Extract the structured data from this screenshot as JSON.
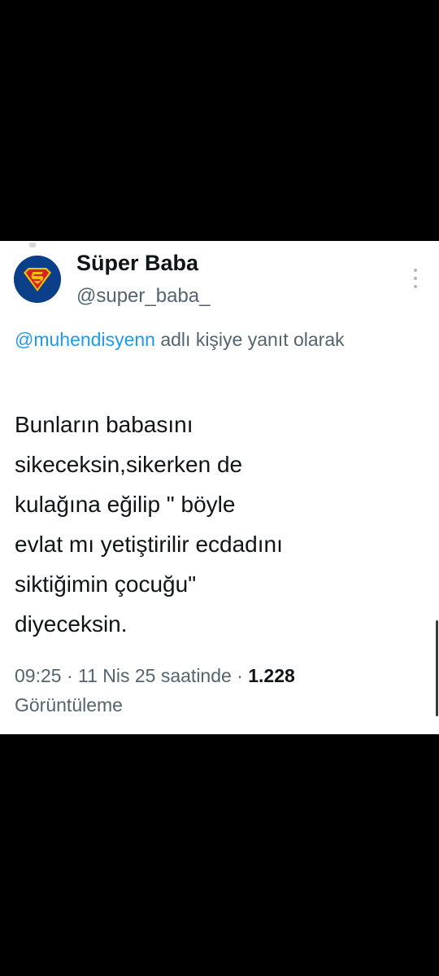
{
  "tweet": {
    "author": {
      "display_name": "Süper Baba",
      "handle": "@super_baba_",
      "avatar_icon": "superman-logo-icon"
    },
    "reply_context": {
      "mention": "@muhendisyenn",
      "suffix": " adlı kişiye yanıt olarak"
    },
    "text": "Bunların babasını\nsikeceksin,sikerken de\nkulağına eğilip \" böyle\nevlat mı yetiştirilir ecdadını\nsiktiğimin çocuğu\"\ndiyeceksin.",
    "meta": {
      "time_date": "09:25 · 11 Nis 25 saatinde · ",
      "views_count": "1.228",
      "views_label": "Görüntüleme"
    }
  },
  "colors": {
    "background": "#000000",
    "card": "#ffffff",
    "primary_text": "#0f1419",
    "secondary_text": "#536471",
    "mention": "#1d9bf0",
    "avatar_bg": "#0b3f8a"
  }
}
